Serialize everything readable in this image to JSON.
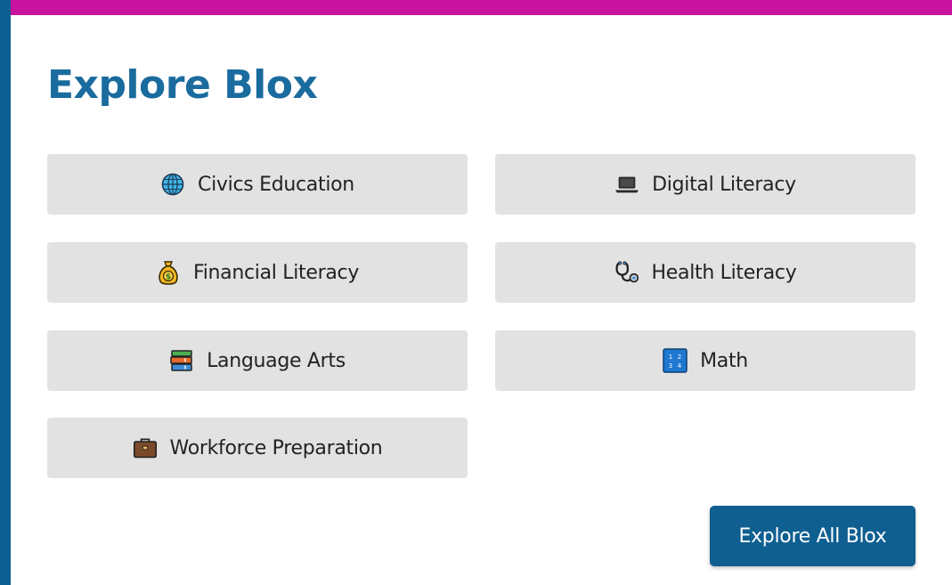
{
  "page": {
    "title": "Explore Blox"
  },
  "topics": [
    {
      "label": "Civics Education",
      "icon": "globe-icon"
    },
    {
      "label": "Digital Literacy",
      "icon": "laptop-icon"
    },
    {
      "label": "Financial Literacy",
      "icon": "money-bag-icon"
    },
    {
      "label": "Health Literacy",
      "icon": "stethoscope-icon"
    },
    {
      "label": "Language Arts",
      "icon": "books-icon"
    },
    {
      "label": "Math",
      "icon": "numbers-icon"
    },
    {
      "label": "Workforce Preparation",
      "icon": "briefcase-icon"
    }
  ],
  "cta": {
    "label": "Explore All Blox"
  },
  "colors": {
    "accent_bar": "#c8139e",
    "side_bar": "#0d5f93",
    "title": "#1a6b9e",
    "tile_bg": "#e2e2e2",
    "button_bg": "#0f5f91"
  }
}
